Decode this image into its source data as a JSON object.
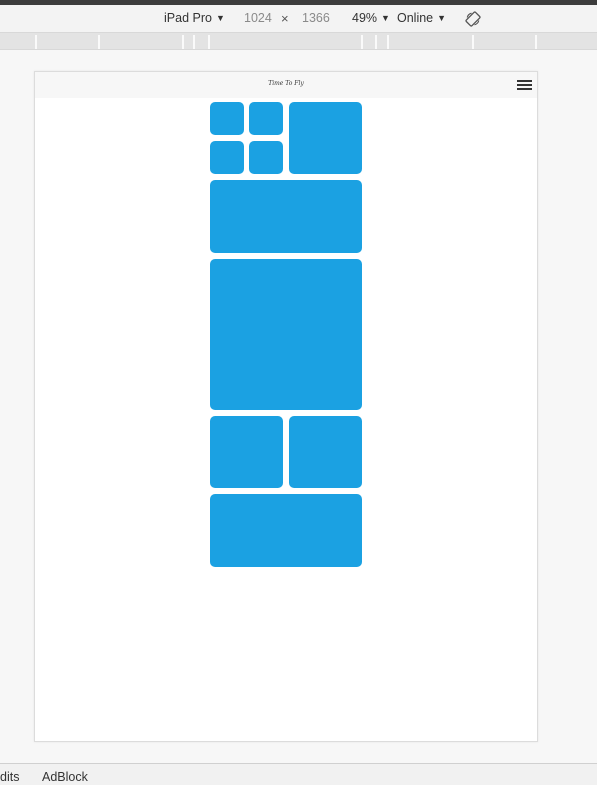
{
  "toolbar": {
    "device": "iPad Pro",
    "width": "1024",
    "times": "×",
    "height": "1366",
    "zoom": "49%",
    "network": "Online",
    "rotate_icon": "rotate-icon"
  },
  "site": {
    "brand": "Time To Fly",
    "menu_icon": "hamburger-menu-icon",
    "tile_color": "#1ba1e2"
  },
  "bottom_tabs": [
    "dits",
    "AdBlock"
  ]
}
